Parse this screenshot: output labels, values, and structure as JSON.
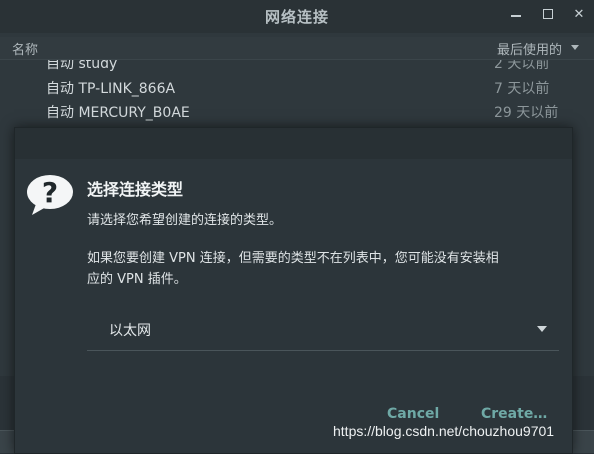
{
  "window": {
    "title": "网络连接",
    "min_icon": "minimize-icon",
    "max_icon": "maximize-icon",
    "close_glyph": "✕"
  },
  "list": {
    "col_name": "名称",
    "col_last_used": "最后使用的",
    "rows": [
      {
        "name": "自动 study",
        "last_used": "2 天以前"
      },
      {
        "name": "自动 TP-LINK_866A",
        "last_used": "7 天以前"
      },
      {
        "name": "自动 MERCURY_B0AE",
        "last_used": "29 天以前"
      }
    ]
  },
  "dialog": {
    "icon": "question-icon",
    "title": "选择连接类型",
    "subtitle": "请选择您希望创建的连接的类型。",
    "body": "如果您要创建 VPN 连接，但需要的类型不在列表中，您可能没有安装相应的 VPN 插件。",
    "select_value": "以太网",
    "cancel_label": "Cancel",
    "create_label": "Create…"
  },
  "watermark": "https://blog.csdn.net/chouzhou9701",
  "colors": {
    "background": "#2b3338",
    "dialog": "#2c353a",
    "accent_button": "#6fa9a6"
  }
}
